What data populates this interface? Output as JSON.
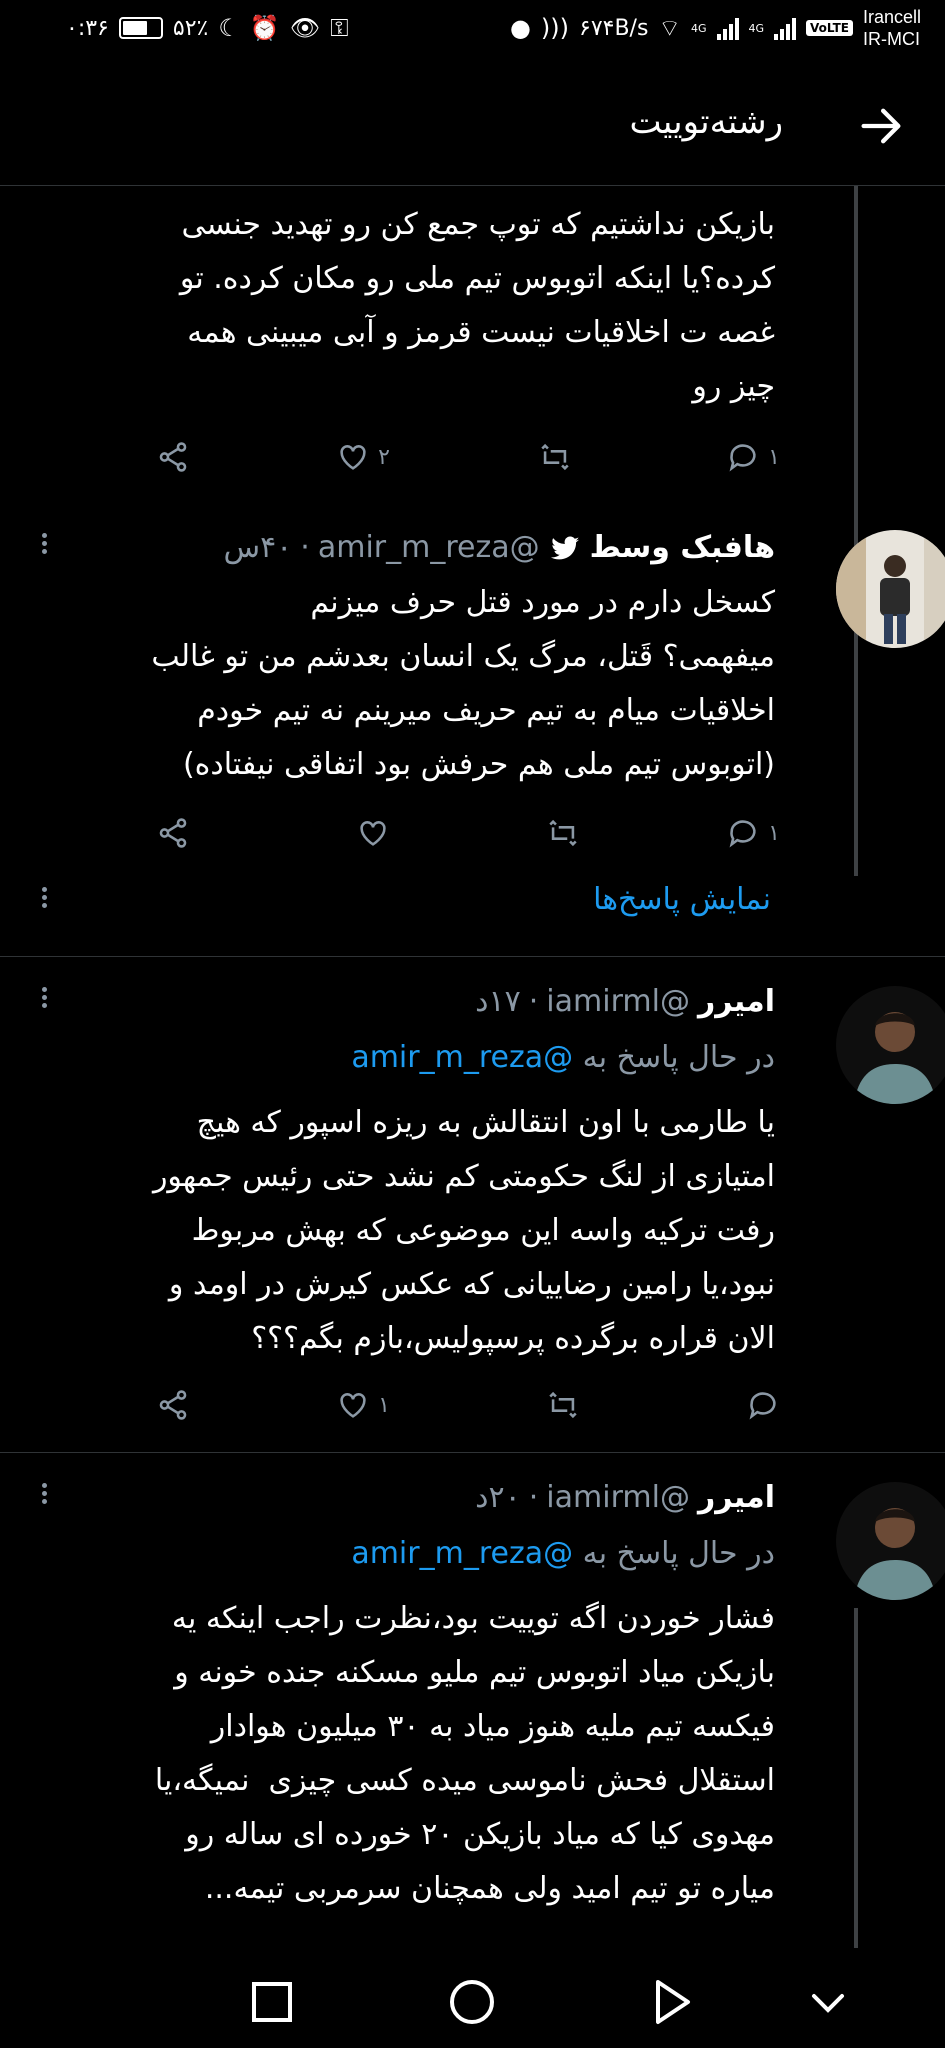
{
  "status_bar": {
    "time": "۰:۳۶",
    "battery": "۵۲٪",
    "net_speed": "۶۷۴B/s",
    "signal1": "4G",
    "signal2": "4G",
    "volte": "VoLTE",
    "carrier_line1": "Irancell",
    "carrier_line2": "IR-MCI"
  },
  "header": {
    "title": "رشته‌توییت"
  },
  "tweets": [
    {
      "text": "بازیکن نداشتیم که توپ جمع کن رو تهدید جنسی\nکرده؟یا اینکه اتوبوس تیم ملی رو مکان کرده. تو\nغصه ت اخلاقیات نیست قرمز و آبی میبینی همه\nچیز رو",
      "replies": "۱",
      "retweets": "",
      "likes": "۲"
    },
    {
      "name": "هافبک وسط",
      "handle": "@amir_m_reza",
      "time": "۴۰س",
      "text": "کسخل دارم در مورد قتل حرف میزنم\nمیفهمی؟ قَتل، مرگ یک انسان بعدشم من تو غالب\nاخلاقیات میام به تیم حریف میرینم نه تیم خودم\n(اتوبوس تیم ملی هم حرفش بود اتفاقی نیفتاده)",
      "replies": "۱",
      "retweets": "",
      "likes": "",
      "show_replies": "نمایش پاسخ‌ها"
    },
    {
      "name": "امیرر",
      "handle": "@iamirml",
      "time": "۱۷د",
      "reply_prefix": "در حال پاسخ به",
      "reply_to": "@amir_m_reza",
      "text": "یا طارمی با اون انتقالش به ریزه اسپور که هیچ\nامتیازی از لنگ حکومتی کم نشد حتی رئیس جمهور\nرفت ترکیه واسه این موضوعی که بهش مربوط\nنبود،یا رامین رضاییانی که عکس کیرش در اومد و\nالان قراره برگرده پرسپولیس،بازم بگم؟؟؟",
      "replies": "",
      "retweets": "",
      "likes": "۱"
    },
    {
      "name": "امیرر",
      "handle": "@iamirml",
      "time": "۲۰د",
      "reply_prefix": "در حال پاسخ به",
      "reply_to": "@amir_m_reza",
      "text": "فشار خوردن اگه توییت بود،نظرت راجب اینکه یه\nبازیکن میاد اتوبوس تیم ملیو مسکنه جنده خونه و\nفیکسه تیم ملیه هنوز میاد به ۳۰ میلیون هوادار\nاستقلال فحش ناموسی میده کسی چیزی  نمیگه،یا\nمهدوی کیا که میاد بازیکن ۲۰ خورده ای ساله رو\nمیاره تو تیم امید ولی همچنان سرمربی تیمه..."
    }
  ],
  "icons": {
    "back": "arrow-right-icon",
    "reply": "comment-icon",
    "retweet": "retweet-icon",
    "like": "heart-icon",
    "share": "share-icon",
    "more": "more-vertical-icon",
    "verified": "twitter-bird-icon"
  },
  "colors": {
    "accent": "#1d9bf0",
    "muted": "#8b98a5",
    "bg": "#000000"
  }
}
